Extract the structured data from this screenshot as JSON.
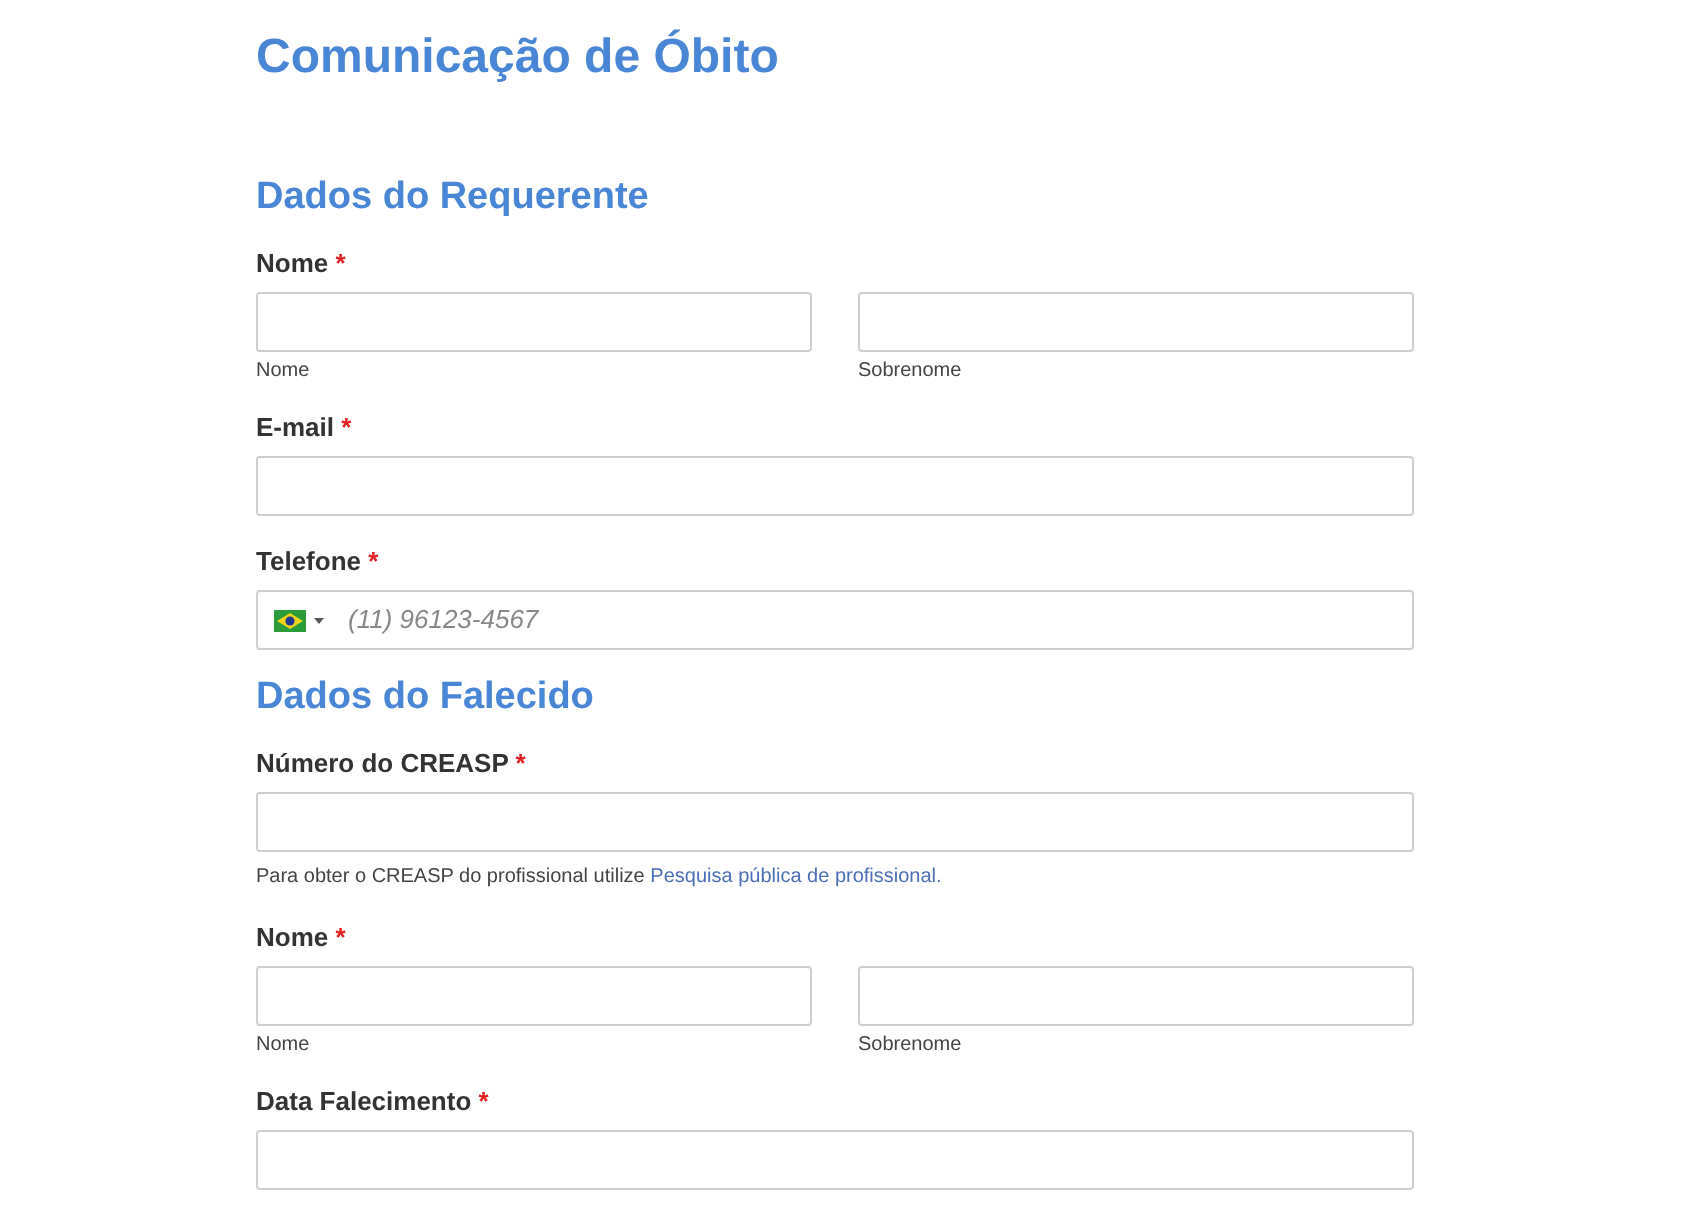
{
  "title": "Comunicação de Óbito",
  "sections": [
    {
      "heading": "Dados do Requerente",
      "fields": [
        {
          "kind": "name",
          "label": "Nome",
          "required_mark": "*",
          "sublabels": [
            "Nome",
            "Sobrenome"
          ]
        },
        {
          "kind": "text",
          "label": "E-mail",
          "required_mark": "*"
        },
        {
          "kind": "phone",
          "label": "Telefone",
          "required_mark": "*",
          "placeholder": "(11) 96123-4567"
        }
      ]
    },
    {
      "heading": "Dados do Falecido",
      "fields": [
        {
          "kind": "text",
          "label": "Número do CREASP",
          "required_mark": "*",
          "help": {
            "text": "Para obter o CREASP do profissional utilize",
            "link": "Pesquisa pública de profissional."
          }
        },
        {
          "kind": "name",
          "label": "Nome",
          "required_mark": "*",
          "sublabels": [
            "Nome",
            "Sobrenome"
          ]
        },
        {
          "kind": "text",
          "label": "Data Falecimento",
          "required_mark": "*"
        }
      ]
    }
  ]
}
